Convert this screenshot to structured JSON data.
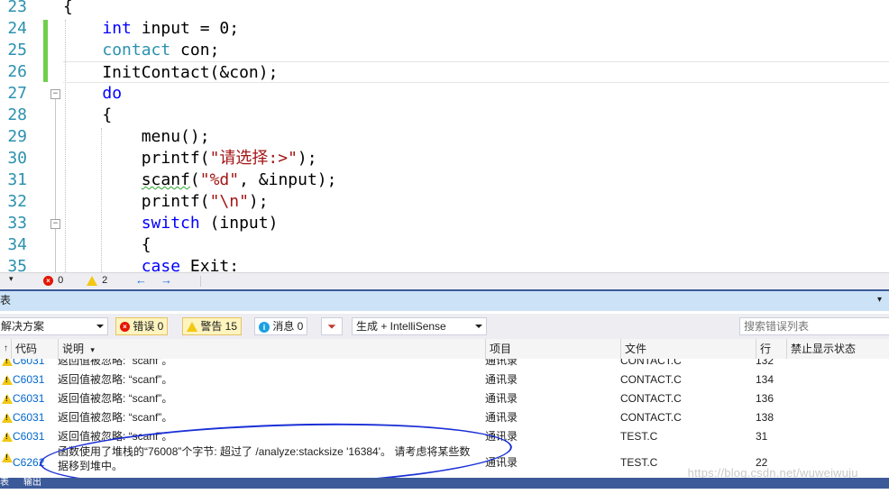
{
  "editor": {
    "line_numbers": [
      "23",
      "24",
      "25",
      "26",
      "27",
      "28",
      "29",
      "30",
      "31",
      "32",
      "33",
      "34",
      "35"
    ],
    "lines": [
      [
        {
          "t": "{",
          "c": ""
        }
      ],
      [
        {
          "t": "    ",
          "c": ""
        },
        {
          "t": "int",
          "c": "kw"
        },
        {
          "t": " input = 0;",
          "c": ""
        }
      ],
      [
        {
          "t": "    ",
          "c": ""
        },
        {
          "t": "contact",
          "c": "ty"
        },
        {
          "t": " con;",
          "c": ""
        }
      ],
      [
        {
          "t": "    InitContact(&con);",
          "c": ""
        }
      ],
      [
        {
          "t": "    ",
          "c": ""
        },
        {
          "t": "do",
          "c": "kw"
        }
      ],
      [
        {
          "t": "    {",
          "c": ""
        }
      ],
      [
        {
          "t": "        menu();",
          "c": ""
        }
      ],
      [
        {
          "t": "        printf(",
          "c": ""
        },
        {
          "t": "\"请选择:>\"",
          "c": "st"
        },
        {
          "t": ");",
          "c": ""
        }
      ],
      [
        {
          "t": "        ",
          "c": ""
        },
        {
          "t": "scanf",
          "c": "squig"
        },
        {
          "t": "(",
          "c": ""
        },
        {
          "t": "\"%d\"",
          "c": "st"
        },
        {
          "t": ", &input);",
          "c": ""
        }
      ],
      [
        {
          "t": "        printf(",
          "c": ""
        },
        {
          "t": "\"\\n\"",
          "c": "st"
        },
        {
          "t": ");",
          "c": ""
        }
      ],
      [
        {
          "t": "        ",
          "c": ""
        },
        {
          "t": "switch",
          "c": "kw"
        },
        {
          "t": " (input)",
          "c": ""
        }
      ],
      [
        {
          "t": "        {",
          "c": ""
        }
      ],
      [
        {
          "t": "        ",
          "c": ""
        },
        {
          "t": "case",
          "c": "kw"
        },
        {
          "t": " Exit:",
          "c": ""
        }
      ]
    ]
  },
  "edit_status": {
    "zoom": "",
    "errors": "0",
    "warnings": "2"
  },
  "panel": {
    "title": "表",
    "scope": "解决方案",
    "errors_btn": "错误 0",
    "warnings_btn": "警告 15",
    "messages_btn": "消息 0",
    "build_filter": "生成 + IntelliSense",
    "search_placeholder": "搜索错误列表"
  },
  "columns": {
    "code": "代码",
    "description": "说明",
    "project": "项目",
    "file": "文件",
    "line": "行",
    "suppression": "禁止显示状态"
  },
  "rows": [
    {
      "code": "C6031",
      "desc": "返回值被忽略: “scanf”。",
      "project": "通讯录",
      "file": "CONTACT.C",
      "line": "132"
    },
    {
      "code": "C6031",
      "desc": "返回值被忽略: “scanf”。",
      "project": "通讯录",
      "file": "CONTACT.C",
      "line": "134"
    },
    {
      "code": "C6031",
      "desc": "返回值被忽略: “scanf”。",
      "project": "通讯录",
      "file": "CONTACT.C",
      "line": "136"
    },
    {
      "code": "C6031",
      "desc": "返回值被忽略: “scanf”。",
      "project": "通讯录",
      "file": "CONTACT.C",
      "line": "138"
    },
    {
      "code": "C6031",
      "desc": "返回值被忽略: “scanf”。",
      "project": "通讯录",
      "file": "TEST.C",
      "line": "31"
    }
  ],
  "last_row": {
    "code": "C6262",
    "desc_1": "函数使用了堆栈的“76008”个字节: 超过了 /analyze:stacksize '16384'。 请考虑将某些数",
    "desc_2": "据移到堆中。",
    "project": "通讯录",
    "file": "TEST.C",
    "line": "22"
  },
  "watermark": "https://blog.csdn.net/wuweiwuju___",
  "bottom_tabs": {
    "left": "表",
    "output": "输出"
  },
  "colors": {
    "keyword": "#0000ff",
    "type": "#2b91af",
    "string": "#a31515",
    "link": "#0066cc",
    "annotation": "#1a2fd6"
  }
}
